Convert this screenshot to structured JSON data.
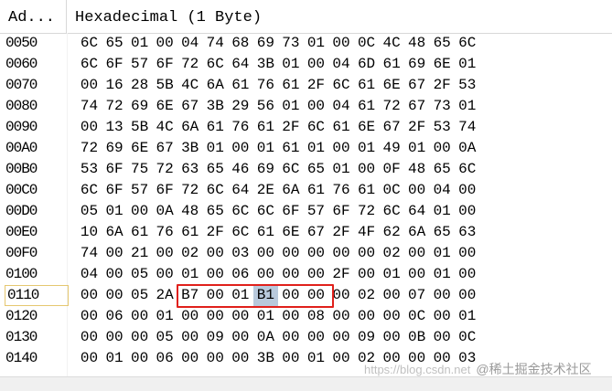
{
  "columns": {
    "address": "Ad...",
    "data": "Hexadecimal (1 Byte)"
  },
  "rows": [
    {
      "address": "0050",
      "bytes": [
        "6C",
        "65",
        "01",
        "00",
        "04",
        "74",
        "68",
        "69",
        "73",
        "01",
        "00",
        "0C",
        "4C",
        "48",
        "65",
        "6C"
      ]
    },
    {
      "address": "0060",
      "bytes": [
        "6C",
        "6F",
        "57",
        "6F",
        "72",
        "6C",
        "64",
        "3B",
        "01",
        "00",
        "04",
        "6D",
        "61",
        "69",
        "6E",
        "01"
      ]
    },
    {
      "address": "0070",
      "bytes": [
        "00",
        "16",
        "28",
        "5B",
        "4C",
        "6A",
        "61",
        "76",
        "61",
        "2F",
        "6C",
        "61",
        "6E",
        "67",
        "2F",
        "53"
      ]
    },
    {
      "address": "0080",
      "bytes": [
        "74",
        "72",
        "69",
        "6E",
        "67",
        "3B",
        "29",
        "56",
        "01",
        "00",
        "04",
        "61",
        "72",
        "67",
        "73",
        "01"
      ]
    },
    {
      "address": "0090",
      "bytes": [
        "00",
        "13",
        "5B",
        "4C",
        "6A",
        "61",
        "76",
        "61",
        "2F",
        "6C",
        "61",
        "6E",
        "67",
        "2F",
        "53",
        "74"
      ]
    },
    {
      "address": "00A0",
      "bytes": [
        "72",
        "69",
        "6E",
        "67",
        "3B",
        "01",
        "00",
        "01",
        "61",
        "01",
        "00",
        "01",
        "49",
        "01",
        "00",
        "0A"
      ]
    },
    {
      "address": "00B0",
      "bytes": [
        "53",
        "6F",
        "75",
        "72",
        "63",
        "65",
        "46",
        "69",
        "6C",
        "65",
        "01",
        "00",
        "0F",
        "48",
        "65",
        "6C"
      ]
    },
    {
      "address": "00C0",
      "bytes": [
        "6C",
        "6F",
        "57",
        "6F",
        "72",
        "6C",
        "64",
        "2E",
        "6A",
        "61",
        "76",
        "61",
        "0C",
        "00",
        "04",
        "00"
      ]
    },
    {
      "address": "00D0",
      "bytes": [
        "05",
        "01",
        "00",
        "0A",
        "48",
        "65",
        "6C",
        "6C",
        "6F",
        "57",
        "6F",
        "72",
        "6C",
        "64",
        "01",
        "00"
      ]
    },
    {
      "address": "00E0",
      "bytes": [
        "10",
        "6A",
        "61",
        "76",
        "61",
        "2F",
        "6C",
        "61",
        "6E",
        "67",
        "2F",
        "4F",
        "62",
        "6A",
        "65",
        "63"
      ]
    },
    {
      "address": "00F0",
      "bytes": [
        "74",
        "00",
        "21",
        "00",
        "02",
        "00",
        "03",
        "00",
        "00",
        "00",
        "00",
        "00",
        "02",
        "00",
        "01",
        "00"
      ]
    },
    {
      "address": "0100",
      "bytes": [
        "04",
        "00",
        "05",
        "00",
        "01",
        "00",
        "06",
        "00",
        "00",
        "00",
        "2F",
        "00",
        "01",
        "00",
        "01",
        "00"
      ]
    },
    {
      "address": "0110",
      "bytes": [
        "00",
        "00",
        "05",
        "2A",
        "B7",
        "00",
        "01",
        "B1",
        "00",
        "00",
        "00",
        "02",
        "00",
        "07",
        "00",
        "00"
      ]
    },
    {
      "address": "0120",
      "bytes": [
        "00",
        "06",
        "00",
        "01",
        "00",
        "00",
        "00",
        "01",
        "00",
        "08",
        "00",
        "00",
        "00",
        "0C",
        "00",
        "01"
      ]
    },
    {
      "address": "0130",
      "bytes": [
        "00",
        "00",
        "00",
        "05",
        "00",
        "09",
        "00",
        "0A",
        "00",
        "00",
        "00",
        "09",
        "00",
        "0B",
        "00",
        "0C"
      ]
    },
    {
      "address": "0140",
      "bytes": [
        "00",
        "01",
        "00",
        "06",
        "00",
        "00",
        "00",
        "3B",
        "00",
        "01",
        "00",
        "02",
        "00",
        "00",
        "00",
        "03"
      ]
    }
  ],
  "current_row": 12,
  "selected_byte": {
    "row": 12,
    "col": 7
  },
  "highlight": {
    "row": 12,
    "from_col": 3,
    "to_col": 7,
    "color": "#e0201b"
  },
  "selection_color": "#b8c9dc",
  "watermark": {
    "text": "https://blog.csdn.net",
    "author": "@稀土掘金技术社区"
  }
}
